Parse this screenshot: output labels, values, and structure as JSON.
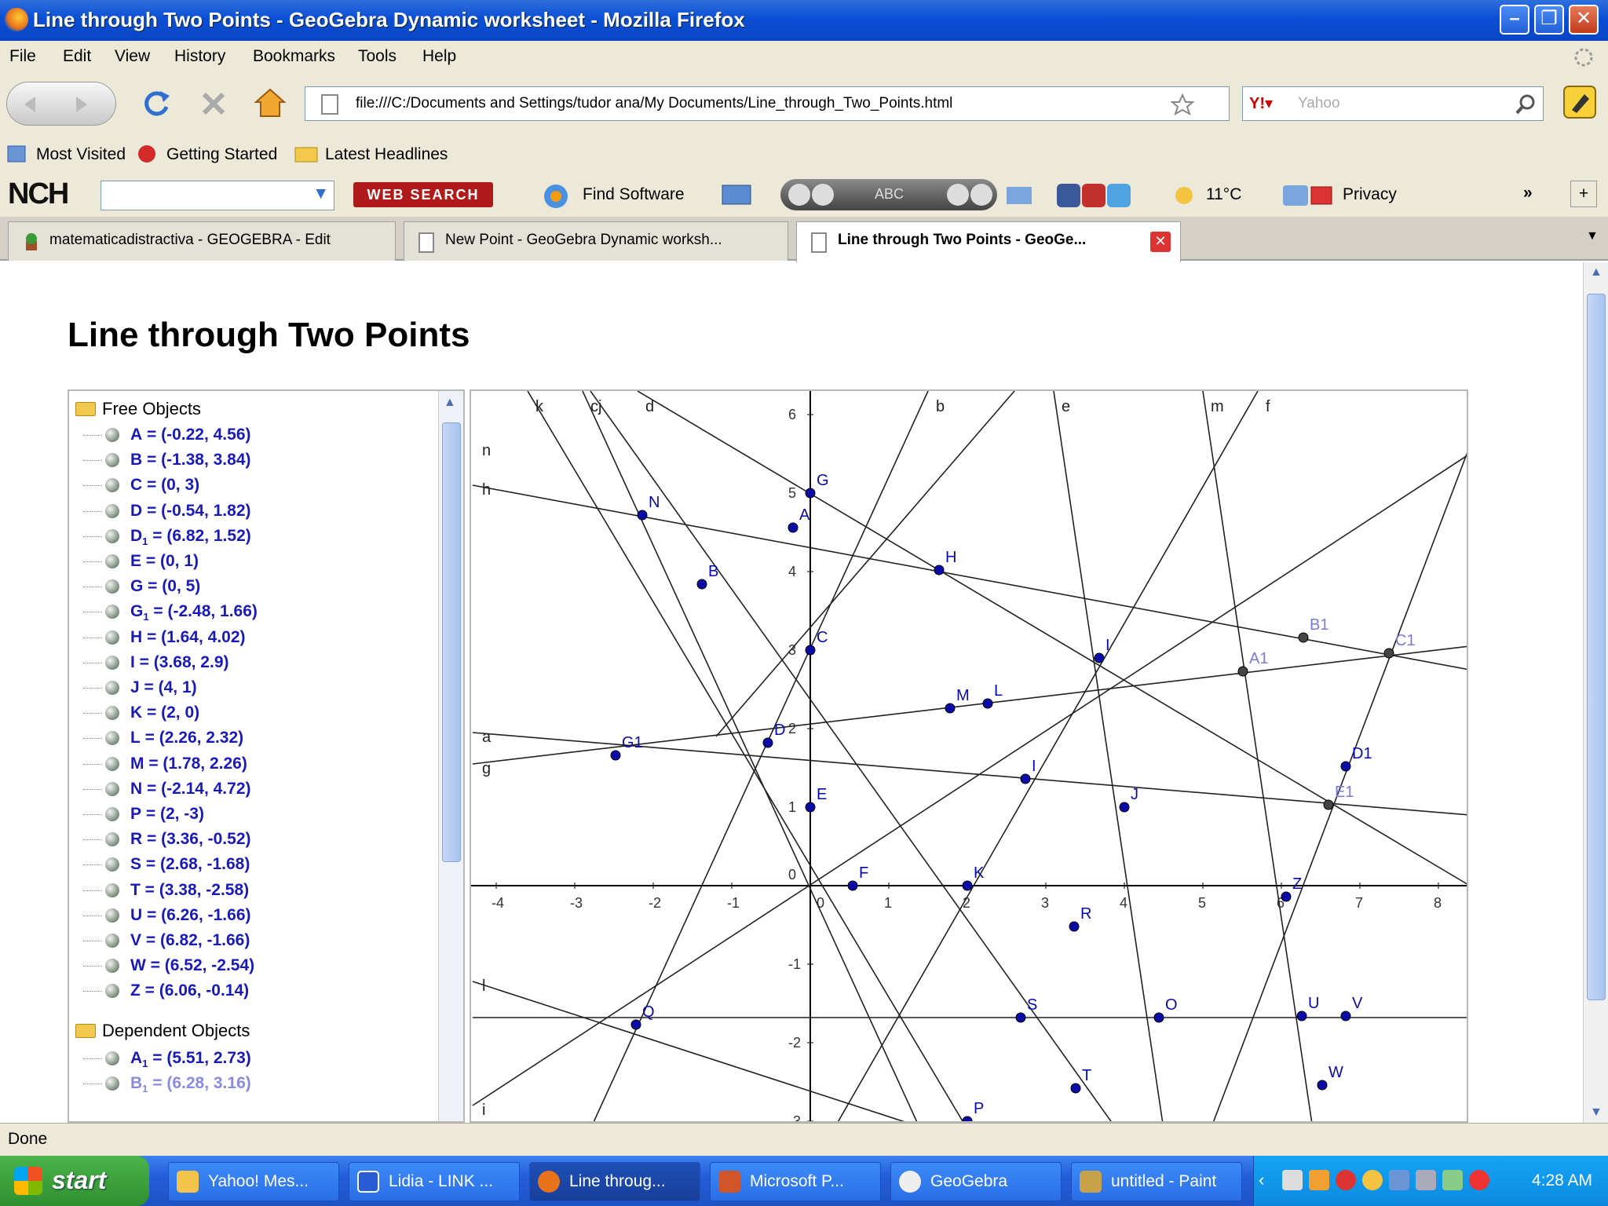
{
  "window": {
    "title": "Line through Two Points - GeoGebra Dynamic worksheet - Mozilla Firefox"
  },
  "menu": [
    "File",
    "Edit",
    "View",
    "History",
    "Bookmarks",
    "Tools",
    "Help"
  ],
  "nav": {
    "url": "file:///C:/Documents and Settings/tudor ana/My Documents/Line_through_Two_Points.html",
    "search_placeholder": "Yahoo"
  },
  "bookmarks": [
    "Most Visited",
    "Getting Started",
    "Latest Headlines"
  ],
  "toolbar2": {
    "brand": "NCH",
    "web_search": "WEB SEARCH",
    "find_software": "Find Software",
    "abc": "ABC",
    "temperature": "11°C",
    "privacy": "Privacy"
  },
  "tabs": [
    {
      "label": "matematicadistractiva - GEOGEBRA - Edit"
    },
    {
      "label": "New Point - GeoGebra Dynamic worksh..."
    },
    {
      "label": "Line through Two Points - GeoGe..."
    }
  ],
  "page": {
    "title": "Line through Two Points"
  },
  "algebra": {
    "free_folder": "Free Objects",
    "dependent_folder": "Dependent Objects",
    "free": [
      {
        "name": "A",
        "sub": "",
        "value": " = (-0.22, 4.56)"
      },
      {
        "name": "B",
        "sub": "",
        "value": " = (-1.38, 3.84)"
      },
      {
        "name": "C",
        "sub": "",
        "value": " = (0, 3)"
      },
      {
        "name": "D",
        "sub": "",
        "value": " = (-0.54, 1.82)"
      },
      {
        "name": "D",
        "sub": "1",
        "value": " = (6.82, 1.52)"
      },
      {
        "name": "E",
        "sub": "",
        "value": " = (0, 1)"
      },
      {
        "name": "G",
        "sub": "",
        "value": " = (0, 5)"
      },
      {
        "name": "G",
        "sub": "1",
        "value": " = (-2.48, 1.66)"
      },
      {
        "name": "H",
        "sub": "",
        "value": " = (1.64, 4.02)"
      },
      {
        "name": "I",
        "sub": "",
        "value": " = (3.68, 2.9)"
      },
      {
        "name": "J",
        "sub": "",
        "value": " = (4, 1)"
      },
      {
        "name": "K",
        "sub": "",
        "value": " = (2, 0)"
      },
      {
        "name": "L",
        "sub": "",
        "value": " = (2.26, 2.32)"
      },
      {
        "name": "M",
        "sub": "",
        "value": " = (1.78, 2.26)"
      },
      {
        "name": "N",
        "sub": "",
        "value": " = (-2.14, 4.72)"
      },
      {
        "name": "P",
        "sub": "",
        "value": " = (2, -3)"
      },
      {
        "name": "R",
        "sub": "",
        "value": " = (3.36, -0.52)"
      },
      {
        "name": "S",
        "sub": "",
        "value": " = (2.68, -1.68)"
      },
      {
        "name": "T",
        "sub": "",
        "value": " = (3.38, -2.58)"
      },
      {
        "name": "U",
        "sub": "",
        "value": " = (6.26, -1.66)"
      },
      {
        "name": "V",
        "sub": "",
        "value": " = (6.82, -1.66)"
      },
      {
        "name": "W",
        "sub": "",
        "value": " = (6.52, -2.54)"
      },
      {
        "name": "Z",
        "sub": "",
        "value": " = (6.06, -0.14)"
      }
    ],
    "dependent": [
      {
        "name": "A",
        "sub": "1",
        "value": " = (5.51, 2.73)"
      },
      {
        "name": "B",
        "sub": "1",
        "value": " = (6.28, 3.16)"
      }
    ]
  },
  "graph": {
    "x_ticks": [
      "-4",
      "-3",
      "-2",
      "-1",
      "0",
      "1",
      "2",
      "3",
      "4",
      "5",
      "6",
      "7",
      "8"
    ],
    "y_ticks": [
      "6",
      "5",
      "4",
      "3",
      "2",
      "1",
      "-1",
      "-2",
      "-3"
    ],
    "points": [
      {
        "label": "A",
        "x": -0.22,
        "y": 4.56
      },
      {
        "label": "B",
        "x": -1.38,
        "y": 3.84
      },
      {
        "label": "C",
        "x": 0,
        "y": 3
      },
      {
        "label": "D",
        "x": -0.54,
        "y": 1.82
      },
      {
        "label": "D1",
        "x": 6.82,
        "y": 1.52
      },
      {
        "label": "E",
        "x": 0,
        "y": 1
      },
      {
        "label": "G",
        "x": 0,
        "y": 5
      },
      {
        "label": "G1",
        "x": -2.48,
        "y": 1.66
      },
      {
        "label": "H",
        "x": 1.64,
        "y": 4.02
      },
      {
        "label": "I",
        "x": 3.68,
        "y": 2.9
      },
      {
        "label": "J",
        "x": 4,
        "y": 1
      },
      {
        "label": "K",
        "x": 2,
        "y": 0
      },
      {
        "label": "L",
        "x": 2.26,
        "y": 2.32
      },
      {
        "label": "M",
        "x": 1.78,
        "y": 2.26
      },
      {
        "label": "N",
        "x": -2.14,
        "y": 4.72
      },
      {
        "label": "P",
        "x": 2,
        "y": -3
      },
      {
        "label": "R",
        "x": 3.36,
        "y": -0.52
      },
      {
        "label": "S",
        "x": 2.68,
        "y": -1.68
      },
      {
        "label": "T",
        "x": 3.38,
        "y": -2.58
      },
      {
        "label": "U",
        "x": 6.26,
        "y": -1.66
      },
      {
        "label": "V",
        "x": 6.82,
        "y": -1.66
      },
      {
        "label": "W",
        "x": 6.52,
        "y": -2.54
      },
      {
        "label": "Z",
        "x": 6.06,
        "y": -0.14
      },
      {
        "label": "A1",
        "x": 5.51,
        "y": 2.73
      },
      {
        "label": "B1",
        "x": 6.28,
        "y": 3.16
      },
      {
        "label": "C1",
        "x": 7.37,
        "y": 2.96
      },
      {
        "label": "E1",
        "x": 6.6,
        "y": 1.03
      },
      {
        "label": "F",
        "x": 0.54,
        "y": 0
      },
      {
        "label": "I",
        "x": 2.74,
        "y": 1.36
      },
      {
        "label": "O",
        "x": 4.44,
        "y": -1.68
      },
      {
        "label": "Q",
        "x": -2.22,
        "y": -1.77
      }
    ],
    "lines": [
      {
        "label": "a",
        "p1": [
          -4.3,
          1.95
        ],
        "p2": [
          8.4,
          0.9
        ]
      },
      {
        "label": "g",
        "p1": [
          -4.3,
          1.55
        ],
        "p2": [
          8.4,
          3.05
        ]
      },
      {
        "label": "h",
        "p1": [
          -4.3,
          5.1
        ],
        "p2": [
          8.4,
          2.75
        ]
      },
      {
        "label": "l",
        "p1": [
          -4.3,
          -1.22
        ],
        "p2": [
          2.1,
          -3.3
        ]
      },
      {
        "label": "i",
        "p1": [
          -4.3,
          -2.8
        ],
        "p2": [
          8.4,
          5.5
        ]
      },
      {
        "label": "k",
        "p1": [
          -3.6,
          6.3
        ],
        "p2": [
          2.0,
          -3.1
        ]
      },
      {
        "label": "c",
        "p1": [
          -2.9,
          6.3
        ],
        "p2": [
          1.4,
          -3.1
        ]
      },
      {
        "label": "j",
        "p1": [
          -2.8,
          6.3
        ],
        "p2": [
          3.9,
          -3.1
        ]
      },
      {
        "label": "d",
        "p1": [
          -2.2,
          6.3
        ],
        "p2": [
          8.4,
          0.0
        ]
      },
      {
        "label": "b",
        "p1": [
          1.5,
          6.3
        ],
        "p2": [
          -2.8,
          -3.1
        ]
      },
      {
        "label": "e",
        "p1": [
          3.1,
          6.3
        ],
        "p2": [
          4.5,
          -3.1
        ]
      },
      {
        "label": "m",
        "p1": [
          5.0,
          6.3
        ],
        "p2": [
          6.4,
          -3.1
        ]
      },
      {
        "label": "f",
        "p1": [
          5.7,
          6.3
        ],
        "p2": [
          0.3,
          -3.1
        ]
      },
      {
        "label": "n",
        "p1": [
          8.4,
          5.6
        ],
        "p2": [
          5.1,
          -3.1
        ]
      },
      {
        "label": "",
        "p1": [
          -1.2,
          1.9
        ],
        "p2": [
          2.6,
          6.3
        ]
      },
      {
        "label": "",
        "p1": [
          -4.3,
          -1.68
        ],
        "p2": [
          8.4,
          -1.68
        ]
      }
    ]
  },
  "status": "Done",
  "taskbar": {
    "start": "start",
    "tasks": [
      "Yahoo! Mes...",
      "Lidia - LINK ...",
      "Line throug...",
      "Microsoft P...",
      "GeoGebra",
      "untitled - Paint"
    ],
    "clock": "4:28 AM"
  }
}
